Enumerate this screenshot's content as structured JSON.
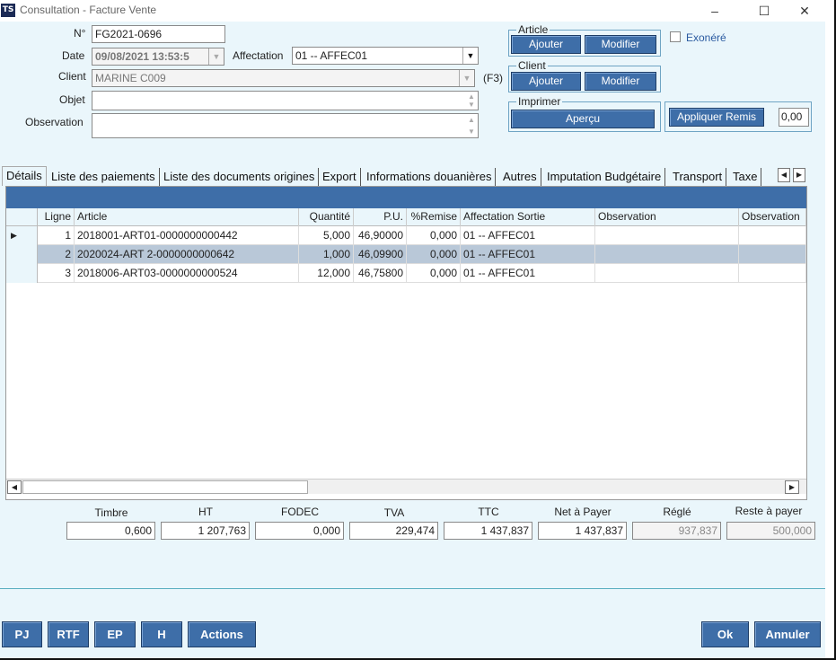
{
  "window": {
    "title": "Consultation - Facture Vente",
    "app_icon": "TS"
  },
  "form": {
    "numero_label": "N°",
    "numero_value": "FG2021-0696",
    "date_label": "Date",
    "date_value": "09/08/2021 13:53:5",
    "affectation_label": "Affectation",
    "affectation_value": "01 -- AFFEC01",
    "client_label": "Client",
    "client_value": "MARINE C009",
    "client_hotkey": "(F3)",
    "objet_label": "Objet",
    "objet_value": "",
    "observation_label": "Observation",
    "observation_value": ""
  },
  "groups": {
    "article": {
      "title": "Article",
      "add": "Ajouter",
      "edit": "Modifier"
    },
    "client": {
      "title": "Client",
      "add": "Ajouter",
      "edit": "Modifier"
    },
    "imprimer": {
      "title": "Imprimer",
      "preview": "Aperçu"
    },
    "exonere_label": "Exonéré",
    "remise_button": "Appliquer Remis",
    "remise_value": "0,00"
  },
  "tabs": [
    "Détails",
    "Liste des paiements",
    "Liste des documents origines",
    "Export",
    "Informations douanières",
    "Autres",
    "Imputation Budgétaire",
    "Transport",
    "Taxe"
  ],
  "grid": {
    "headers": [
      "Ligne",
      "Article",
      "Quantité",
      "P.U.",
      "%Remise",
      "Affectation Sortie",
      "Observation",
      "Observation"
    ],
    "rows": [
      {
        "ligne": "1",
        "article": "2018001-ART01-0000000000442",
        "qte": "5,000",
        "pu": "46,90000",
        "remise": "0,000",
        "affectation": "01 -- AFFEC01",
        "obs1": "",
        "obs2": ""
      },
      {
        "ligne": "2",
        "article": "2020024-ART 2-0000000000642",
        "qte": "1,000",
        "pu": "46,09900",
        "remise": "0,000",
        "affectation": "01 -- AFFEC01",
        "obs1": "",
        "obs2": ""
      },
      {
        "ligne": "3",
        "article": "2018006-ART03-0000000000524",
        "qte": "12,000",
        "pu": "46,75800",
        "remise": "0,000",
        "affectation": "01 -- AFFEC01",
        "obs1": "",
        "obs2": ""
      }
    ],
    "selected_row": 2
  },
  "totals": [
    {
      "label": "Timbre",
      "value": "0,600"
    },
    {
      "label": "HT",
      "value": "1 207,763"
    },
    {
      "label": "FODEC",
      "value": "0,000"
    },
    {
      "label": "TVA",
      "value": "229,474"
    },
    {
      "label": "TTC",
      "value": "1 437,837"
    },
    {
      "label": "Net à Payer",
      "value": "1 437,837"
    },
    {
      "label": "Réglé",
      "value": "937,837"
    },
    {
      "label": "Reste à payer",
      "value": "500,000"
    }
  ],
  "bottom_buttons": {
    "pj": "PJ",
    "rtf": "RTF",
    "ep": "EP",
    "h": "H",
    "actions": "Actions",
    "ok": "Ok",
    "annuler": "Annuler"
  },
  "icons": {
    "minimize": "minimize-icon",
    "maximize": "maximize-icon",
    "close": "close-icon",
    "combo": "chevron-down-icon"
  },
  "colors": {
    "accent": "#3e6ea8",
    "background": "#eaf6fb",
    "selected_row": "#b9c8d8"
  }
}
